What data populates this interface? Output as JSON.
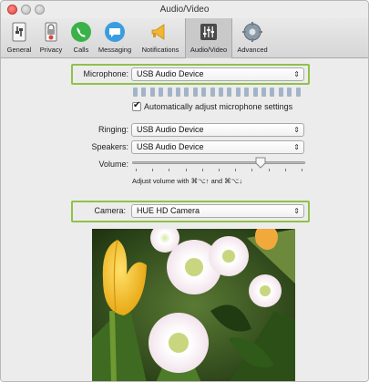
{
  "window": {
    "title": "Audio/Video"
  },
  "toolbar": {
    "items": [
      {
        "label": "General",
        "icon": "general-icon"
      },
      {
        "label": "Privacy",
        "icon": "privacy-icon"
      },
      {
        "label": "Calls",
        "icon": "calls-icon"
      },
      {
        "label": "Messaging",
        "icon": "messaging-icon"
      },
      {
        "label": "Notifications",
        "icon": "notifications-icon"
      },
      {
        "label": "Audio/Video",
        "icon": "audio-video-icon",
        "selected": true
      },
      {
        "label": "Advanced",
        "icon": "advanced-icon"
      }
    ]
  },
  "microphone": {
    "label": "Microphone:",
    "value": "USB Audio Device",
    "auto_adjust_label": "Automatically adjust microphone settings",
    "auto_adjust_checked": true,
    "level_segments": 20
  },
  "ringing": {
    "label": "Ringing:",
    "value": "USB Audio Device"
  },
  "speakers": {
    "label": "Speakers:",
    "value": "USB Audio Device"
  },
  "volume": {
    "label": "Volume:",
    "level": 0.74,
    "hint": "Adjust volume with ⌘⌥↑ and ⌘⌥↓"
  },
  "camera": {
    "label": "Camera:",
    "value": "HUE HD Camera"
  },
  "colors": {
    "highlight": "#8fc24a",
    "close": "#e0443e",
    "meter": "#a4b4c8"
  }
}
